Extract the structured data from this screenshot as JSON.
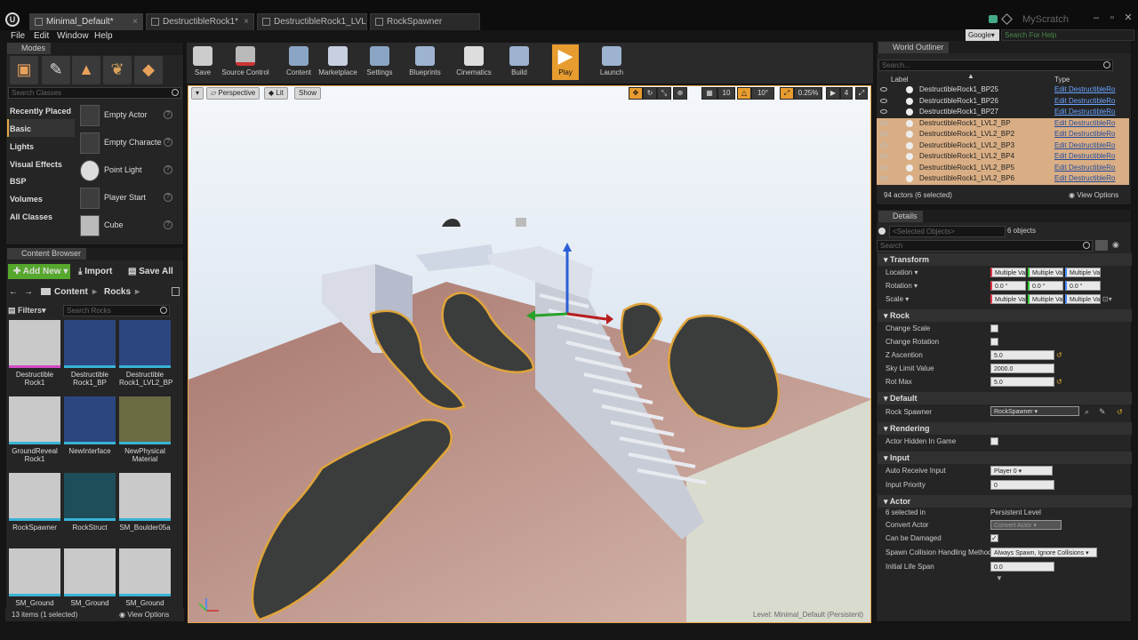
{
  "title_bar": {
    "tabs": [
      "Minimal_Default*",
      "DestructibleRock1*",
      "DestructibleRock1_LVL2_E",
      "RockSpawner"
    ],
    "user": "MyScratch"
  },
  "menu": [
    "File",
    "Edit",
    "Window",
    "Help"
  ],
  "help_search": {
    "engine": "Google▾",
    "placeholder": "Search For Help"
  },
  "modes": {
    "title": "Modes",
    "search_placeholder": "Search Classes",
    "categories": [
      "Recently Placed",
      "Basic",
      "Lights",
      "Visual Effects",
      "BSP",
      "Volumes",
      "All Classes"
    ],
    "items": [
      "Empty Actor",
      "Empty Characte",
      "Point Light",
      "Player Start",
      "Cube"
    ]
  },
  "content_browser": {
    "title": "Content Browser",
    "add_new": "Add New",
    "import": "Import",
    "save_all": "Save All",
    "path": [
      "Content",
      "Rocks"
    ],
    "filters": "Filters",
    "search_placeholder": "Search Rocks",
    "assets": [
      "Destructible Rock1",
      "Destructible Rock1_BP",
      "Destructible Rock1_LVL2_BP",
      "GroundReveal Rock1",
      "NewInterface",
      "NewPhysical Material",
      "RockSpawner",
      "RockStruct",
      "SM_Boulder05a",
      "SM_Ground",
      "SM_Ground",
      "SM_Ground"
    ],
    "status": "13 items (1 selected)",
    "view_options": "View Options"
  },
  "toolbar": [
    "Save",
    "Source Control",
    "Content",
    "Marketplace",
    "Settings",
    "Blueprints",
    "Cinematics",
    "Build",
    "Play",
    "Launch"
  ],
  "viewport": {
    "perspective": "Perspective",
    "lit": "Lit",
    "show": "Show",
    "grid_snap": "10",
    "rot_snap": "10°",
    "scale_snap": "0.25%",
    "camera_speed": "4",
    "level_label": "Level:  Minimal_Default (Persistent)"
  },
  "outliner": {
    "title": "World Outliner",
    "search_placeholder": "Search...",
    "col_label": "Label",
    "col_type": "Type",
    "rows": [
      {
        "label": "DestructibleRock1_BP25",
        "type": "Edit DestructibleRo",
        "selected": false
      },
      {
        "label": "DestructibleRock1_BP26",
        "type": "Edit DestructibleRo",
        "selected": false
      },
      {
        "label": "DestructibleRock1_BP27",
        "type": "Edit DestructibleRo",
        "selected": false
      },
      {
        "label": "DestructibleRock1_LVL2_BP",
        "type": "Edit DestructibleRo",
        "selected": true
      },
      {
        "label": "DestructibleRock1_LVL2_BP2",
        "type": "Edit DestructibleRo",
        "selected": true
      },
      {
        "label": "DestructibleRock1_LVL2_BP3",
        "type": "Edit DestructibleRo",
        "selected": true
      },
      {
        "label": "DestructibleRock1_LVL2_BP4",
        "type": "Edit DestructibleRo",
        "selected": true
      },
      {
        "label": "DestructibleRock1_LVL2_BP5",
        "type": "Edit DestructibleRo",
        "selected": true
      },
      {
        "label": "DestructibleRock1_LVL2_BP6",
        "type": "Edit DestructibleRo",
        "selected": true
      }
    ],
    "status": "94 actors (6 selected)",
    "view_options": "View Options"
  },
  "details": {
    "title": "Details",
    "selected_placeholder": "<Selected Objects>",
    "count": "6 objects",
    "search_placeholder": "Search",
    "transform": {
      "title": "Transform",
      "location": "Location",
      "rotation": "Rotation",
      "scale": "Scale",
      "multi": "Multiple Va",
      "rot_val": "0.0 °"
    },
    "rock": {
      "title": "Rock",
      "change_scale": "Change Scale",
      "change_rotation": "Change Rotation",
      "z_ascention": "Z Ascention",
      "z_val": "5.0",
      "sky_limit": "Sky Limit Value",
      "sky_val": "2000.0",
      "rot_max": "Rot Max",
      "rot_max_val": "5.0"
    },
    "default": {
      "title": "Default",
      "rock_spawner": "Rock Spawner",
      "rock_spawner_val": "RockSpawner"
    },
    "rendering": {
      "title": "Rendering",
      "hidden": "Actor Hidden In Game"
    },
    "input": {
      "title": "Input",
      "auto_receive": "Auto Receive Input",
      "auto_val": "Player 0",
      "priority": "Input Priority",
      "priority_val": "0"
    },
    "actor": {
      "title": "Actor",
      "selected_in": "6 selected in",
      "level": "Persistent Level",
      "convert": "Convert Actor",
      "convert_val": "Convert Actor",
      "damaged": "Can be Damaged",
      "spawn": "Spawn Collision Handling Method",
      "spawn_val": "Always Spawn, Ignore Collisions",
      "life": "Initial Life Span",
      "life_val": "0.0"
    }
  }
}
